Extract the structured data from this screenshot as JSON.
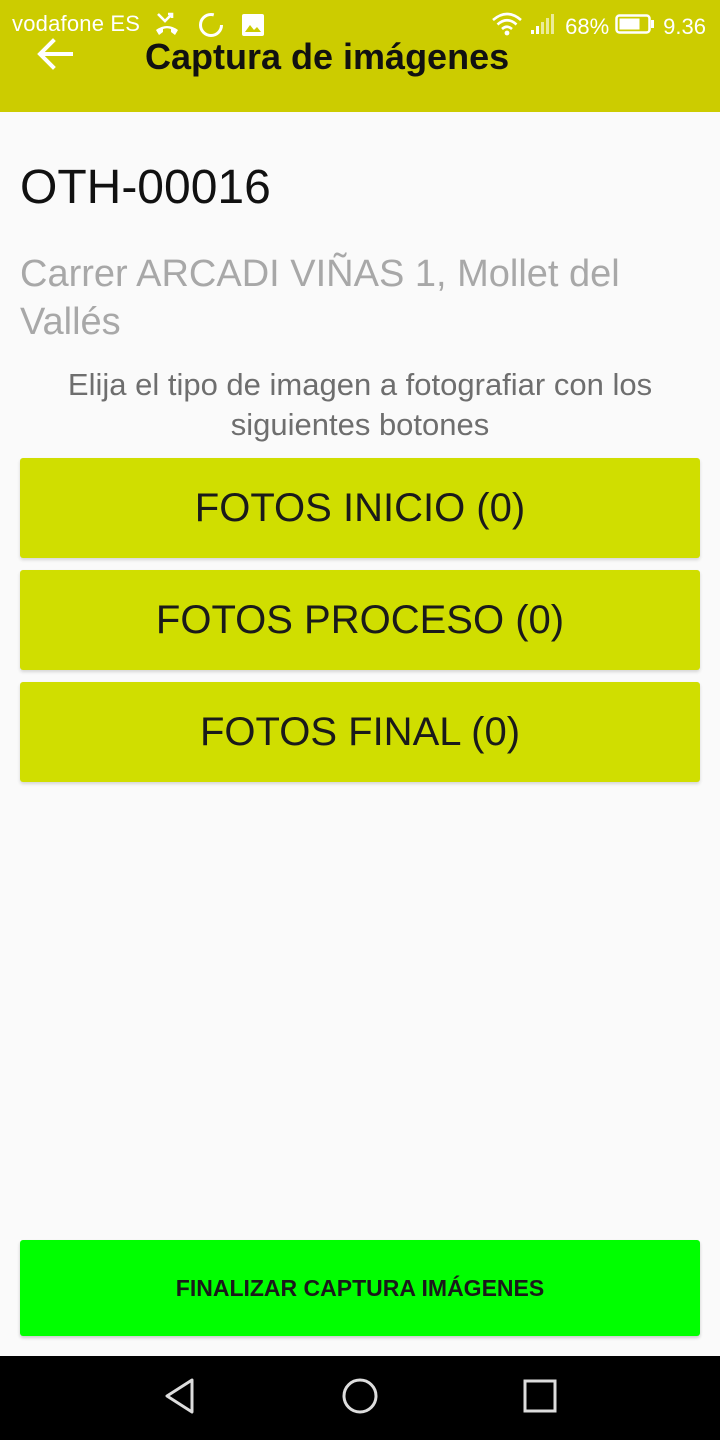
{
  "status_bar": {
    "carrier": "vodafone ES",
    "battery": "68%",
    "time": "9.36"
  },
  "app_bar": {
    "title": "Captura de imágenes",
    "color": "#cccc00"
  },
  "order": {
    "code": "OTH-00016",
    "address": "Carrer ARCADI VIÑAS 1, Mollet del Vallés"
  },
  "instructions": "Elija el tipo de imagen a fotografiar con los siguientes botones",
  "buttons": {
    "start": "FOTOS INICIO (0)",
    "process": "FOTOS PROCESO (0)",
    "final": "FOTOS FINAL (0)",
    "finish": "FINALIZAR CAPTURA IMÁGENES",
    "photo_color": "#d0de00",
    "finish_color": "#00ff00"
  },
  "icons": {
    "back": "arrow-left-icon",
    "nav_back": "triangle-back-icon",
    "nav_home": "circle-home-icon",
    "nav_recent": "square-recent-icon"
  }
}
